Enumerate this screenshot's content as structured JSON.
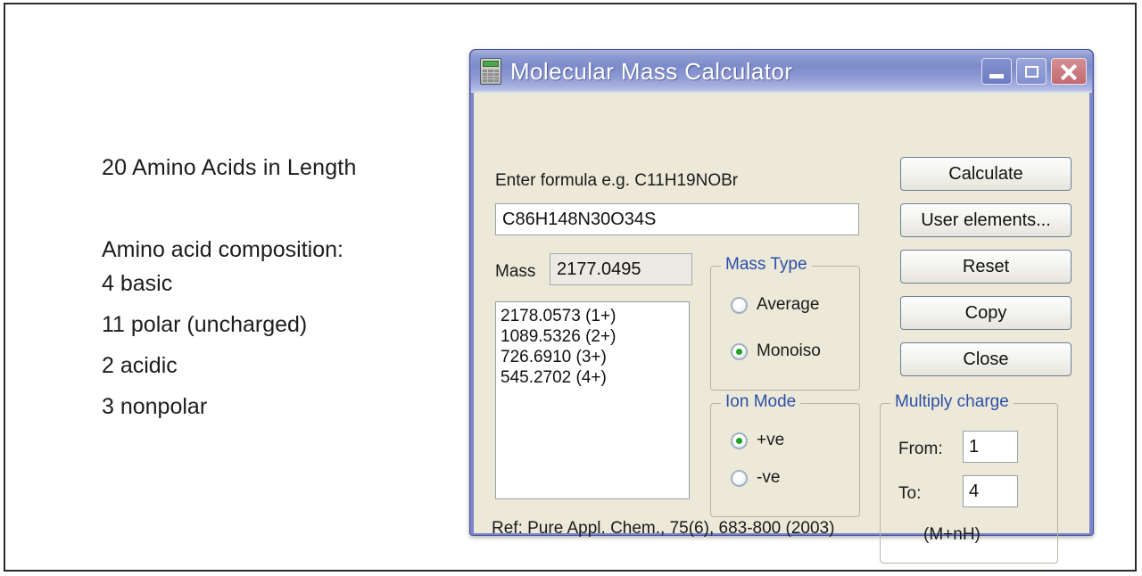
{
  "slide": {
    "notes": {
      "heading": "20 Amino Acids in Length",
      "subheading": "Amino acid composition:",
      "lines": [
        "4 basic",
        "11 polar (uncharged)",
        "2 acidic",
        "3 nonpolar"
      ]
    }
  },
  "dialog": {
    "title": "Molecular Mass Calculator",
    "icon": "calculator-icon",
    "window_controls": {
      "minimize": "minimize-icon",
      "maximize": "maximize-icon",
      "close": "close-icon"
    },
    "formula": {
      "prompt": "Enter formula e.g. C11H19NOBr",
      "value": "C86H148N30O34S",
      "placeholder": "Enter formula e.g. C11H19NOBr"
    },
    "mass": {
      "label": "Mass",
      "value": "2177.0495"
    },
    "results": [
      "2178.0573 (1+)",
      "1089.5326 (2+)",
      "726.6910 (3+)",
      "545.2702 (4+)"
    ],
    "mass_type": {
      "legend": "Mass Type",
      "options": [
        {
          "label": "Average",
          "checked": false
        },
        {
          "label": "Monoiso",
          "checked": true
        }
      ]
    },
    "ion_mode": {
      "legend": "Ion Mode",
      "options": [
        {
          "label": "+ve",
          "checked": true
        },
        {
          "label": "-ve",
          "checked": false
        }
      ]
    },
    "multiply_charge": {
      "legend": "Multiply charge",
      "from_label": "From:",
      "from_value": "1",
      "to_label": "To:",
      "to_value": "4",
      "note": "(M+nH)"
    },
    "buttons": {
      "calculate": "Calculate",
      "user_elements": "User elements...",
      "reset": "Reset",
      "copy": "Copy",
      "close": "Close"
    },
    "reference": "Ref: Pure Appl. Chem., 75(6), 683-800 (2003)"
  },
  "colors": {
    "title_bar": "#8e9bd2",
    "dialog_border": "#7a86c8",
    "dialog_body": "#ece9d8",
    "group_legend": "#2c4ea8",
    "radio_dot": "#22a024",
    "close_button": "#bf6a70",
    "frame": "#2b2b2b"
  }
}
